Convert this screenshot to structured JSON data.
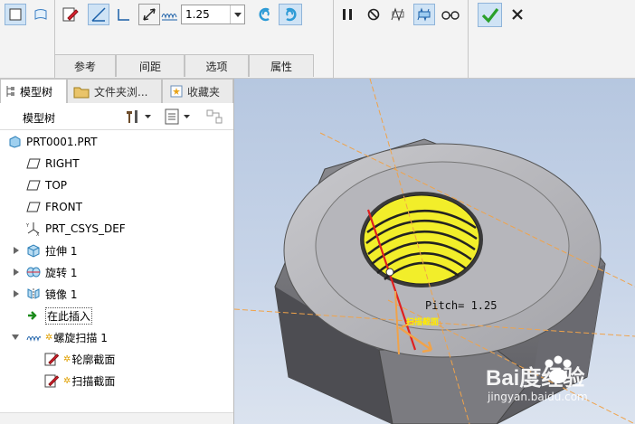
{
  "toolbar": {
    "pitch_value": "1.25",
    "tabs": [
      "参考",
      "间距",
      "选项",
      "属性"
    ],
    "icons": [
      "solid-icon",
      "surface-icon",
      "sketch-icon",
      "helix-right-angle-icon",
      "profile-icon",
      "pitch-direction-icon",
      "pitch-icon",
      "left-hand-icon",
      "right-hand-icon",
      "pause-icon",
      "no-preview-icon",
      "preview-icon",
      "verify-icon",
      "glasses-icon",
      "ok-checkmark-icon",
      "cancel-x-icon"
    ],
    "accent_color": "#2e9bd6",
    "ok_color": "#2aa02a"
  },
  "panel": {
    "tabs": [
      "模型树",
      "文件夹浏...",
      "收藏夹"
    ],
    "header_label": "模型树",
    "tree": [
      {
        "label": "PRT0001.PRT",
        "icon": "part-icon",
        "indent": 0
      },
      {
        "label": "RIGHT",
        "icon": "datum-plane-icon",
        "indent": 1
      },
      {
        "label": "TOP",
        "icon": "datum-plane-icon",
        "indent": 1
      },
      {
        "label": "FRONT",
        "icon": "datum-plane-icon",
        "indent": 1
      },
      {
        "label": "PRT_CSYS_DEF",
        "icon": "csys-icon",
        "indent": 1
      },
      {
        "label": "拉伸 1",
        "icon": "extrude-icon",
        "indent": 1,
        "expander": "collapsed"
      },
      {
        "label": "旋转 1",
        "icon": "revolve-icon",
        "indent": 1,
        "expander": "collapsed"
      },
      {
        "label": "镜像 1",
        "icon": "mirror-icon",
        "indent": 1,
        "expander": "collapsed"
      },
      {
        "label": "在此插入",
        "icon": "insert-here-arrow-icon",
        "indent": 1
      },
      {
        "label": "螺旋扫描 1",
        "icon": "helical-sweep-icon",
        "indent": 1,
        "expander": "expanded"
      },
      {
        "label": "轮廓截面",
        "icon": "sketch-pencil-icon",
        "indent": 2
      },
      {
        "label": "扫描截面",
        "icon": "sketch-pencil-icon",
        "indent": 2
      }
    ]
  },
  "viewport": {
    "pitch_annotation": "Pitch= 1.25",
    "sweep_section_label": "扫描截面",
    "watermark_brand": "Bai度经验",
    "watermark_url": "jingyan.baidu.com",
    "thread_color": "#f2ee2a",
    "body_color": "#a9a9ad"
  }
}
